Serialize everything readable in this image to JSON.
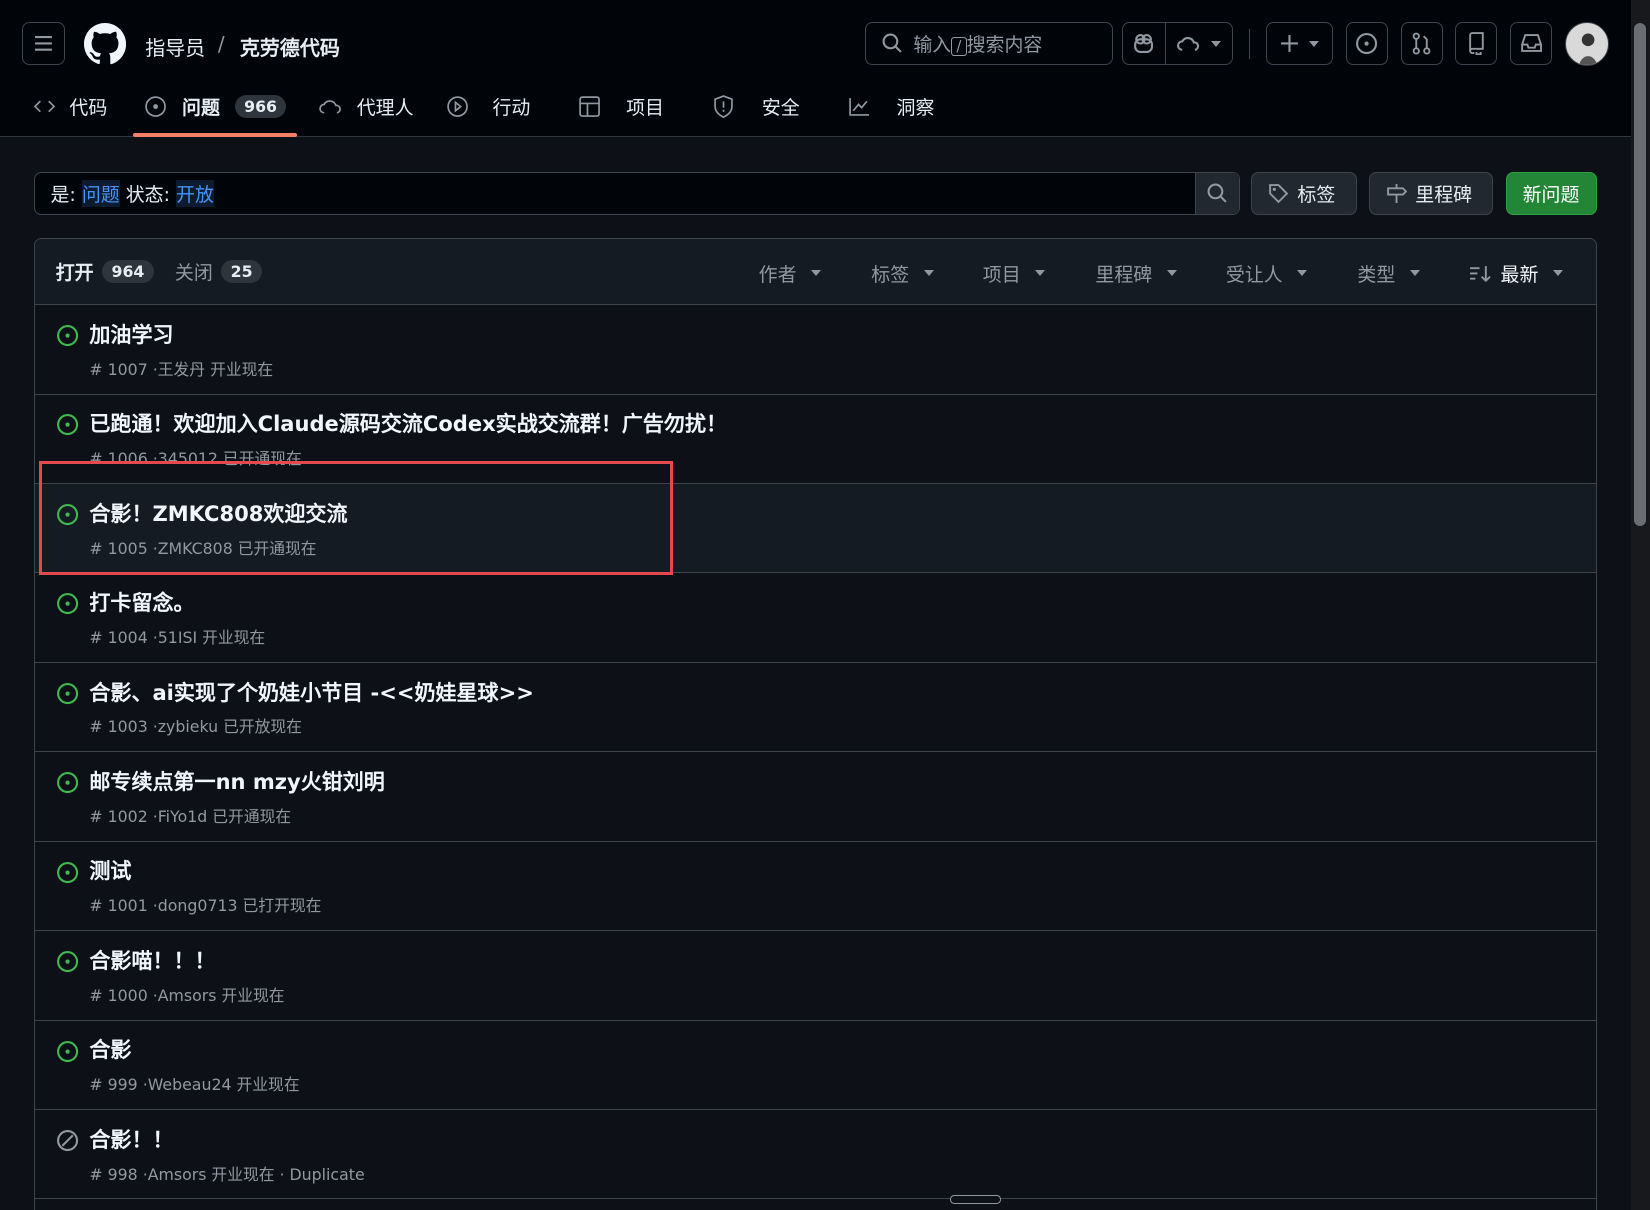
{
  "header": {
    "owner": "指导员",
    "separator": "/",
    "repo": "克劳德代码",
    "search_placeholder_prefix": "输入",
    "search_shortcut": "/",
    "search_placeholder_suffix": "搜索内容"
  },
  "tabs": [
    {
      "label": "代码",
      "icon": "code-icon"
    },
    {
      "label": "问题",
      "icon": "issue-icon",
      "count": "966",
      "active": true
    },
    {
      "label": "代理人",
      "icon": "agent-icon"
    },
    {
      "label": "行动",
      "icon": "play-icon"
    },
    {
      "label": "项目",
      "icon": "table-icon"
    },
    {
      "label": "安全",
      "icon": "shield-icon"
    },
    {
      "label": "洞察",
      "icon": "graph-icon"
    }
  ],
  "filter": {
    "k1": "是:",
    "v1": "问题",
    "k2": "状态:",
    "v2": "开放",
    "labels_button": "标签",
    "milestones_button": "里程碑",
    "new_issue_button": "新问题"
  },
  "list_header": {
    "open_label": "打开",
    "open_count": "964",
    "closed_label": "关闭",
    "closed_count": "25",
    "filters": [
      "作者",
      "标签",
      "项目",
      "里程碑",
      "受让人",
      "类型"
    ],
    "sort": "最新"
  },
  "issues": [
    {
      "title": "加油学习",
      "meta": "# 1007 ·王发丹 开业现在",
      "state": "open"
    },
    {
      "title": "已跑通！欢迎加入Claude源码交流Codex实战交流群！广告勿扰！",
      "meta": "# 1006 ·345012 已开通现在",
      "state": "open"
    },
    {
      "title": "合影！ZMKC808欢迎交流",
      "meta": "# 1005 ·ZMKC808 已开通现在",
      "state": "open"
    },
    {
      "title": "打卡留念。",
      "meta": "# 1004 ·51ISI 开业现在",
      "state": "open"
    },
    {
      "title": "合影、ai实现了个奶娃小节目 -<<奶娃星球>>",
      "meta": "# 1003 ·zybieku 已开放现在",
      "state": "open"
    },
    {
      "title": "邮专续点第一nn mzy火钳刘明",
      "meta": "# 1002 ·FiYo1d 已开通现在",
      "state": "open"
    },
    {
      "title": "测试",
      "meta": "# 1001 ·dong0713 已打开现在",
      "state": "open"
    },
    {
      "title": "合影喵！！！",
      "meta": "# 1000 ·Amsors 开业现在",
      "state": "open"
    },
    {
      "title": "合影",
      "meta": "# 999 ·Webeau24 开业现在",
      "state": "open"
    },
    {
      "title": "合影！！",
      "meta": "# 998 ·Amsors 开业现在 · Duplicate",
      "state": "skipped"
    }
  ],
  "colors": {
    "accent": "#f78166",
    "open": "#3fb950",
    "link": "#4493f8",
    "primary": "#238636",
    "highlight": "#e5484d"
  }
}
